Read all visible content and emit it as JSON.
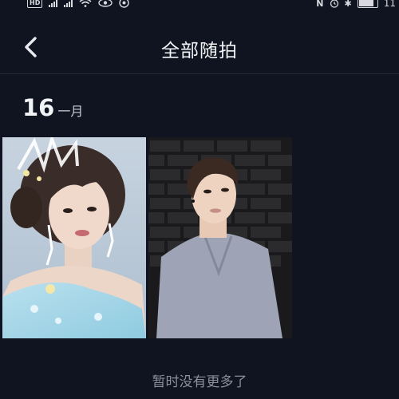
{
  "status_bar": {
    "left_badge": "HD",
    "right_text": "11"
  },
  "header": {
    "back_icon": "chevron-left-icon",
    "title": "全部随拍"
  },
  "feed": {
    "date_day": "16",
    "date_month": "一月",
    "photos": [
      {
        "icon": "photo-woman-bride"
      },
      {
        "icon": "photo-man-brick-wall"
      }
    ],
    "end_message": "暂时没有更多了"
  },
  "colors": {
    "background": "#101420",
    "text": "#f2f3f6",
    "muted": "#8a8f9c"
  }
}
